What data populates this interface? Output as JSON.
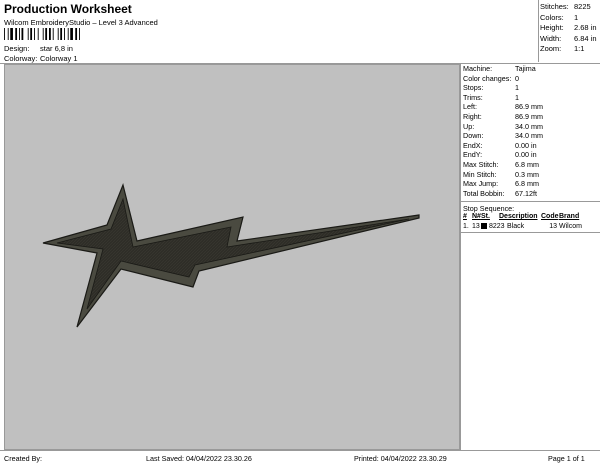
{
  "header": {
    "title": "Production Worksheet",
    "subtitle": "Wilcom EmbroideryStudio – Level 3 Advanced",
    "design_label": "Design:",
    "design_value": "star 6,8  in",
    "colorway_label": "Colorway:",
    "colorway_value": "Colorway 1"
  },
  "stats": {
    "stitches_label": "Stitches:",
    "stitches": "8225",
    "colors_label": "Colors:",
    "colors": "1",
    "height_label": "Height:",
    "height": "2.68 in",
    "width_label": "Width:",
    "width": "6.84 in",
    "zoom_label": "Zoom:",
    "zoom": "1:1"
  },
  "machine": [
    {
      "label": "Machine:",
      "value": "Tajima"
    },
    {
      "label": "Color changes:",
      "value": "0"
    },
    {
      "label": "Stops:",
      "value": "1"
    },
    {
      "label": "Trims:",
      "value": "1"
    },
    {
      "label": "Left:",
      "value": "86.9 mm"
    },
    {
      "label": "Right:",
      "value": "86.9 mm"
    },
    {
      "label": "Up:",
      "value": "34.0 mm"
    },
    {
      "label": "Down:",
      "value": "34.0 mm"
    },
    {
      "label": "EndX:",
      "value": "0.00 in"
    },
    {
      "label": "EndY:",
      "value": "0.00 in"
    },
    {
      "label": "Max Stitch:",
      "value": "6.8 mm"
    },
    {
      "label": "Min Stitch:",
      "value": "0.3 mm"
    },
    {
      "label": "Max Jump:",
      "value": "6.8 mm"
    },
    {
      "label": "Total Bobbin:",
      "value": "67.12ft"
    }
  ],
  "stop_sequence": {
    "title": "Stop Sequence:",
    "headers": [
      "#",
      "N#",
      "St.",
      "Description",
      "Code",
      "Brand"
    ],
    "rows": [
      {
        "num": "1.",
        "n": "13",
        "st": "8223",
        "description": "Black",
        "code": "13",
        "brand": "Wilcom",
        "color": "#000000"
      }
    ]
  },
  "footer": {
    "created_by": "Created By:",
    "last_saved": "Last Saved: 04/04/2022 23.30.26",
    "printed": "Printed: 04/04/2022 23.30.29",
    "page": "Page 1 of 1"
  },
  "colors": {
    "canvas_bg": "#c0c0c0",
    "design_outer": "#4a4a40",
    "design_inner": "#2e2d27",
    "design_edge": "#1a1a16"
  }
}
